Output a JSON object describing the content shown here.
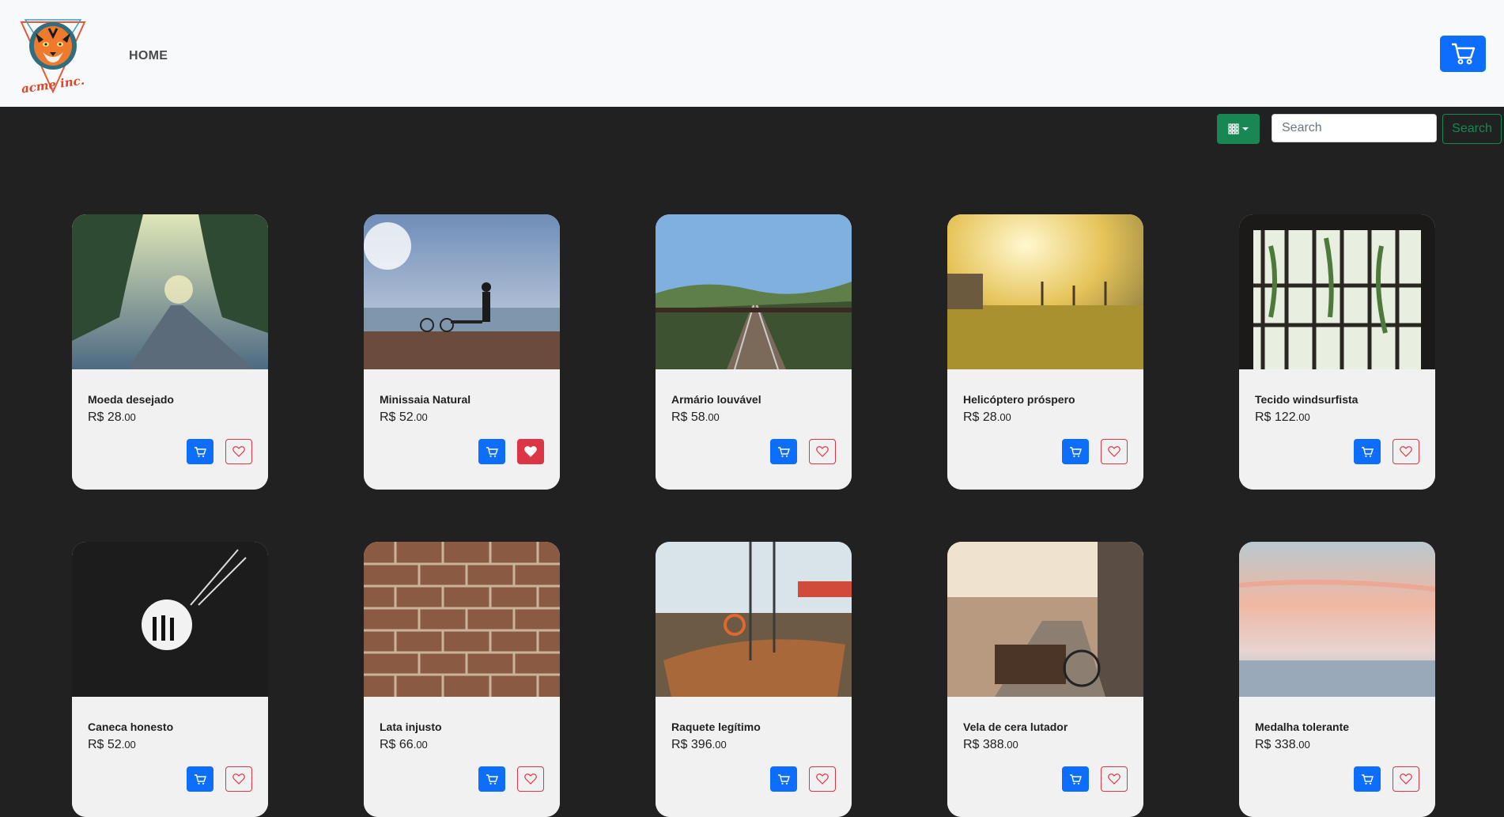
{
  "header": {
    "logo_alt": "ACME INC.",
    "nav": [
      {
        "label": "HOME"
      }
    ],
    "cart_icon": "cart-icon"
  },
  "toolbar": {
    "view_icon": "grid-icon",
    "search_placeholder": "Search",
    "search_value": "",
    "search_button": "Search"
  },
  "products": [
    {
      "name": "Moeda desejado",
      "currency": "R$",
      "price": "28",
      "cents": ".00",
      "favorite": false
    },
    {
      "name": "Minissaia Natural",
      "currency": "R$",
      "price": "52",
      "cents": ".00",
      "favorite": true
    },
    {
      "name": "Armário louvável",
      "currency": "R$",
      "price": "58",
      "cents": ".00",
      "favorite": false
    },
    {
      "name": "Helicóptero próspero",
      "currency": "R$",
      "price": "28",
      "cents": ".00",
      "favorite": false
    },
    {
      "name": "Tecido windsurfista",
      "currency": "R$",
      "price": "122",
      "cents": ".00",
      "favorite": false
    },
    {
      "name": "Caneca honesto",
      "currency": "R$",
      "price": "52",
      "cents": ".00",
      "favorite": false
    },
    {
      "name": "Lata injusto",
      "currency": "R$",
      "price": "66",
      "cents": ".00",
      "favorite": false
    },
    {
      "name": "Raquete legítimo",
      "currency": "R$",
      "price": "396",
      "cents": ".00",
      "favorite": false
    },
    {
      "name": "Vela de cera lutador",
      "currency": "R$",
      "price": "388",
      "cents": ".00",
      "favorite": false
    },
    {
      "name": "Medalha tolerante",
      "currency": "R$",
      "price": "338",
      "cents": ".00",
      "favorite": false
    }
  ],
  "colors": {
    "primary": "#0d6efd",
    "success": "#198754",
    "danger": "#dc3545",
    "background": "#212121"
  }
}
